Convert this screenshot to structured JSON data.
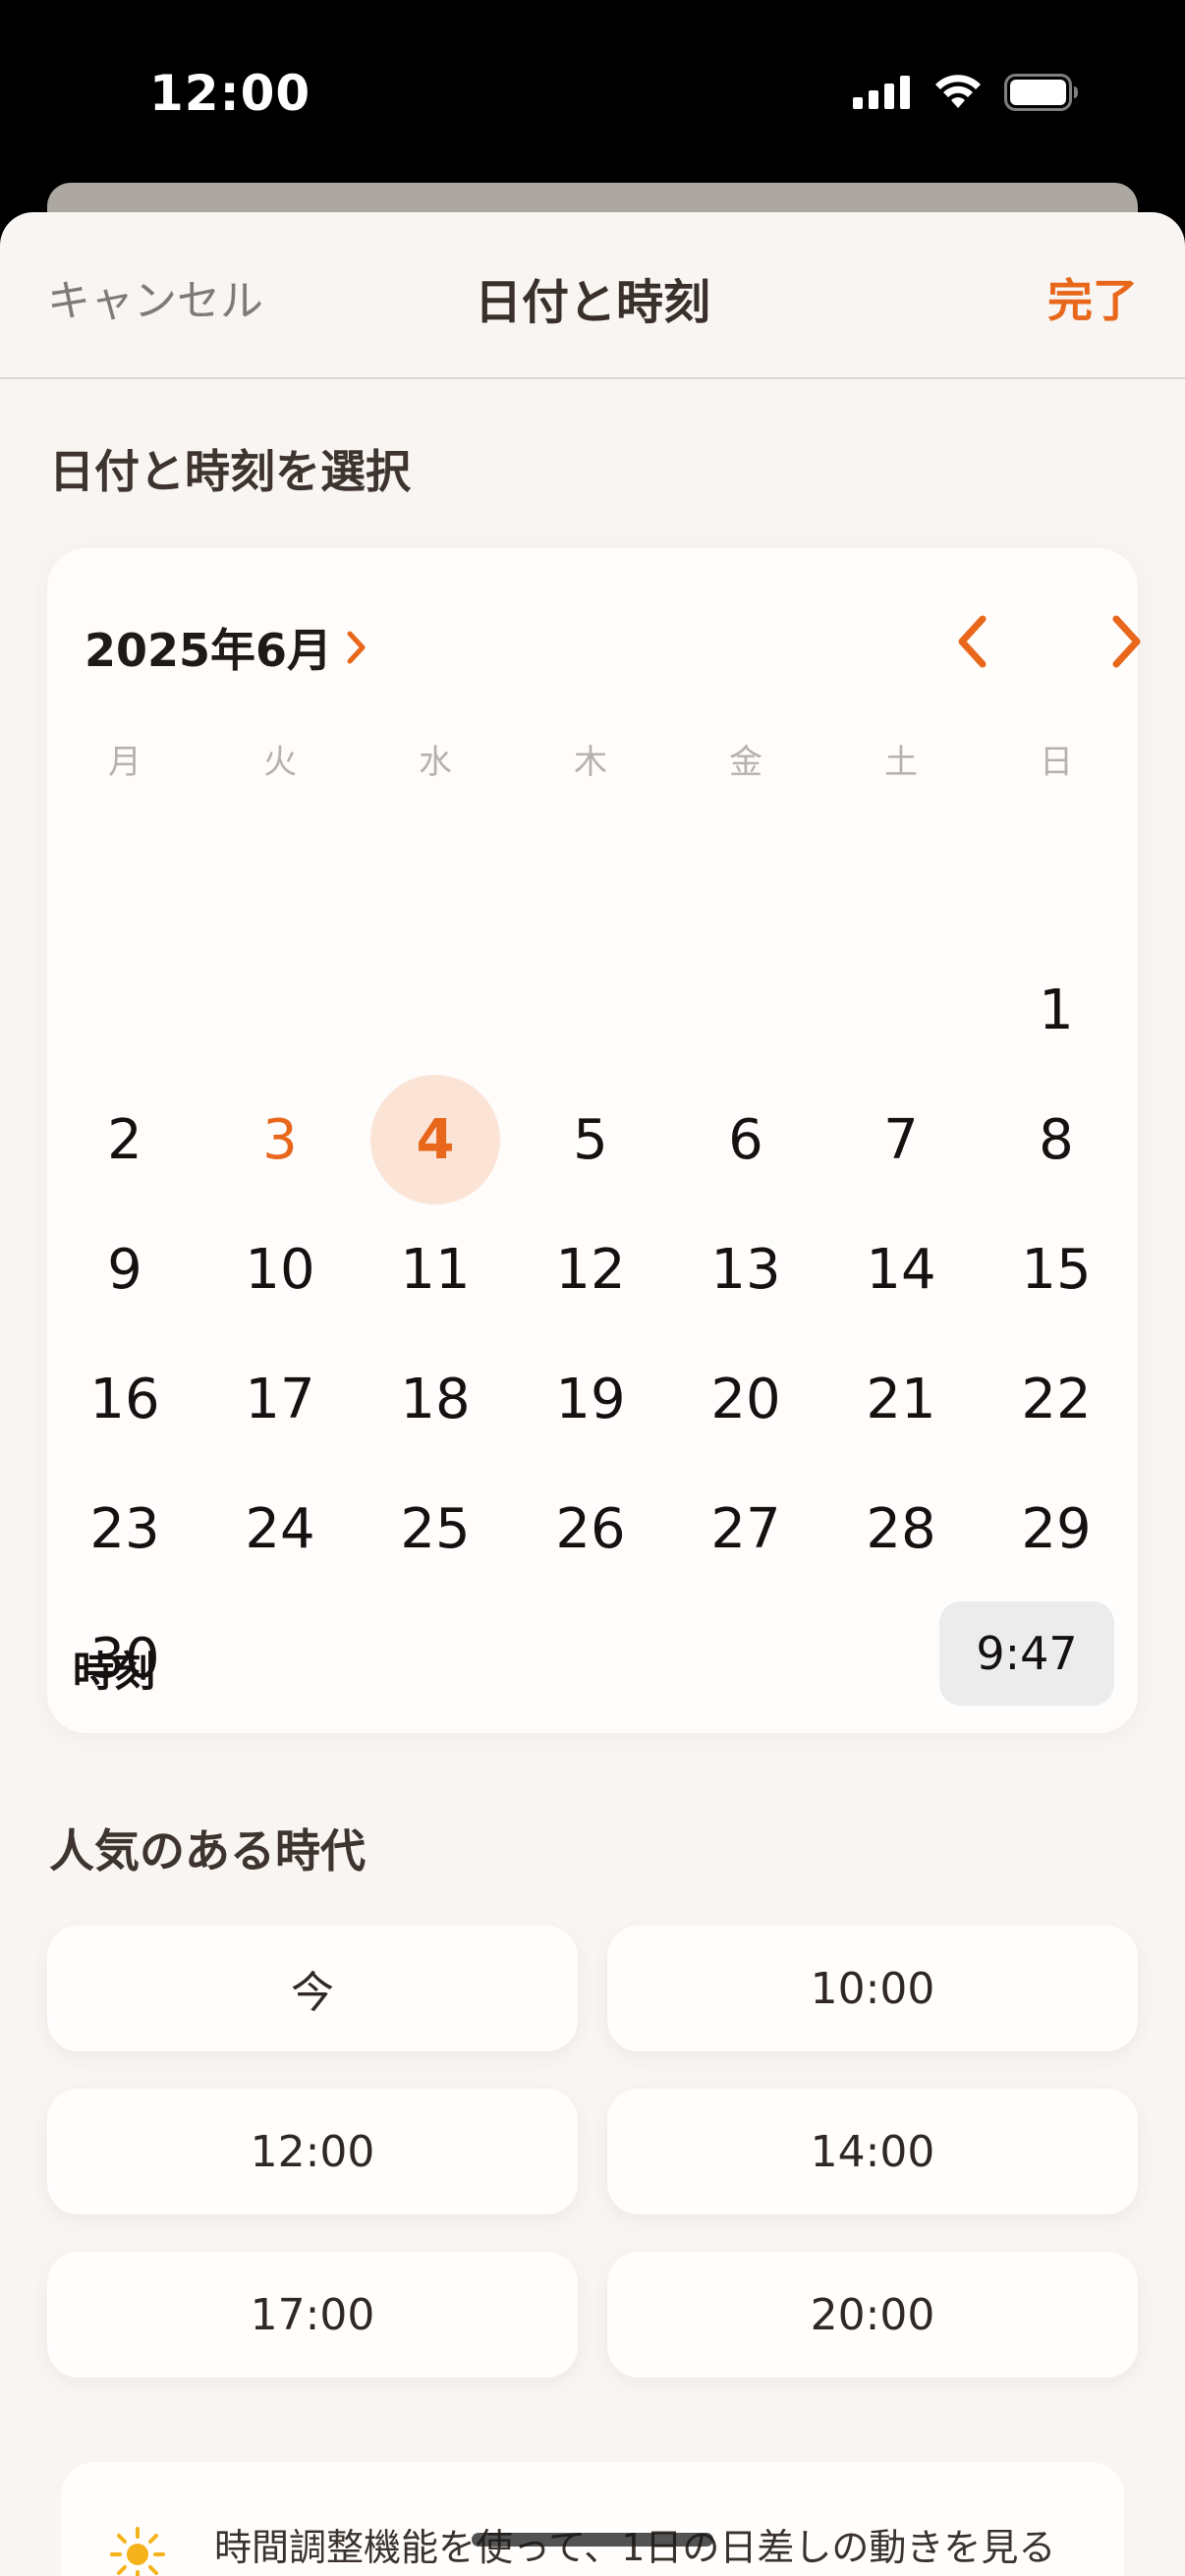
{
  "status_bar": {
    "time": "12:00"
  },
  "nav": {
    "cancel_label": "キャンセル",
    "title": "日付と時刻",
    "done_label": "完了"
  },
  "date_section": {
    "title": "日付と時刻を選択"
  },
  "calendar": {
    "month_label": "2025年6月",
    "weekdays": [
      "月",
      "火",
      "水",
      "木",
      "金",
      "土",
      "日"
    ],
    "first_weekday_index": 6,
    "days_in_month": 30,
    "today": 3,
    "selected": 4,
    "time_label": "時刻",
    "time_value": "9:47"
  },
  "popular_section": {
    "title": "人気のある時代",
    "presets": [
      "今",
      "10:00",
      "12:00",
      "14:00",
      "17:00",
      "20:00"
    ]
  },
  "tip": {
    "icon": "sun-icon",
    "text": "時間調整機能を使って、1日の日差しの動きを見る"
  },
  "colors": {
    "accent": "#e8671b",
    "selected_bg": "#fbe4d6",
    "sheet_bg": "#f8f5f2"
  }
}
